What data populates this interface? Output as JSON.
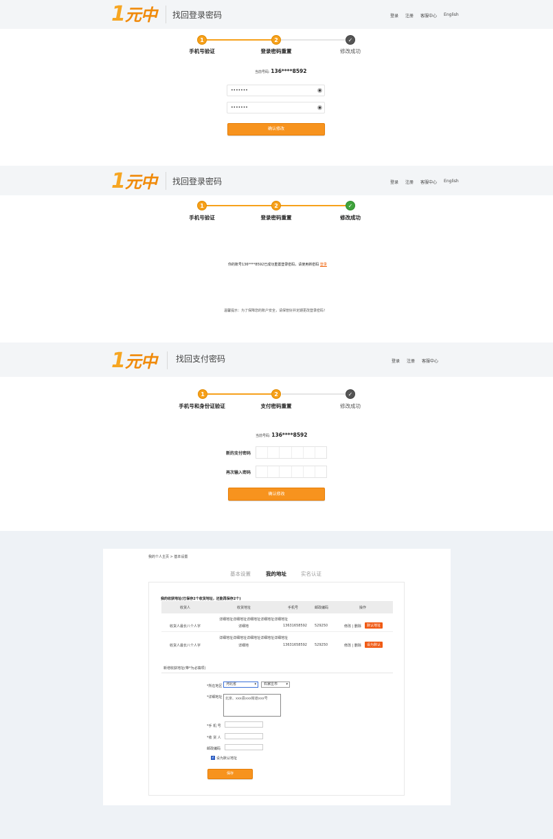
{
  "logo": {
    "text": "元中",
    "number": "1"
  },
  "section1": {
    "title": "找回登录密码",
    "nav": [
      "登录",
      "注册",
      "客服中心",
      "English"
    ],
    "steps": [
      {
        "num": "1",
        "label": "手机号验证"
      },
      {
        "num": "2",
        "label": "登录密码重置"
      },
      {
        "num": "",
        "label": "修改成功"
      }
    ],
    "phone_label": "当前号码:",
    "phone": "136****8592",
    "password1": "•••••••",
    "password2": "•••••••",
    "confirm": "确认修改"
  },
  "section2": {
    "title": "找回登录密码",
    "nav": [
      "登录",
      "注册",
      "客服中心",
      "English"
    ],
    "steps": [
      {
        "num": "1",
        "label": "手机号验证"
      },
      {
        "num": "2",
        "label": "登录密码重置"
      },
      {
        "num": "✓",
        "label": "修改成功"
      }
    ],
    "message": "你的账号136****8592已成功重置登录密码，请使用新密码",
    "login_link": "登录",
    "tip": "温馨提示：为了保障您的账户安全，请保管好并定期更改登录密码！"
  },
  "section3": {
    "title": "找回支付密码",
    "nav": [
      "登录",
      "注册",
      "客服中心"
    ],
    "steps": [
      {
        "num": "1",
        "label": "手机号和身份证验证"
      },
      {
        "num": "2",
        "label": "支付密码重置"
      },
      {
        "num": "",
        "label": "修改成功"
      }
    ],
    "phone_label": "当前号码:",
    "phone": "136****8592",
    "new_pwd_label": "新的支付密码",
    "repeat_pwd_label": "再次输入密码",
    "confirm": "确认修改"
  },
  "section4": {
    "breadcrumb": "我的个人主页 > 基本设置",
    "tabs": [
      "基本设置",
      "我的地址",
      "实名认证"
    ],
    "summary": "我的收获地址(已保存2个收货地址，还能再保存2个)",
    "columns": [
      "收货人",
      "收货地址",
      "手机号",
      "邮政编码",
      "操作"
    ],
    "rows": [
      {
        "name": "收货人最长八个人字",
        "addr1": "详细地址详细地址详细地址详细地址详细地址",
        "addr2": "详细地",
        "phone": "13631658592",
        "zip": "529250",
        "ops": "修改 | 删除",
        "badge": "默认地址"
      },
      {
        "name": "收货人最长八个人字",
        "addr1": "详细地址详细地址详细地址详细地址详细地址",
        "addr2": "详细地",
        "phone": "13631658592",
        "zip": "529250",
        "ops": "修改 | 删除",
        "badge": "设为默认"
      }
    ],
    "new_title": "新增收获地址(带*为必填项)",
    "region_label": "*所在地区",
    "province": "河北省",
    "city": "石家庄市",
    "detail_label": "*详细地址",
    "detail_value": "北京、xxx县xxx街道xxx号",
    "phone_label": "*手  机  号",
    "receiver_label": "*收  货  人",
    "zip_label": "邮政编码",
    "default_label": "设为默认地址",
    "save": "保存"
  }
}
